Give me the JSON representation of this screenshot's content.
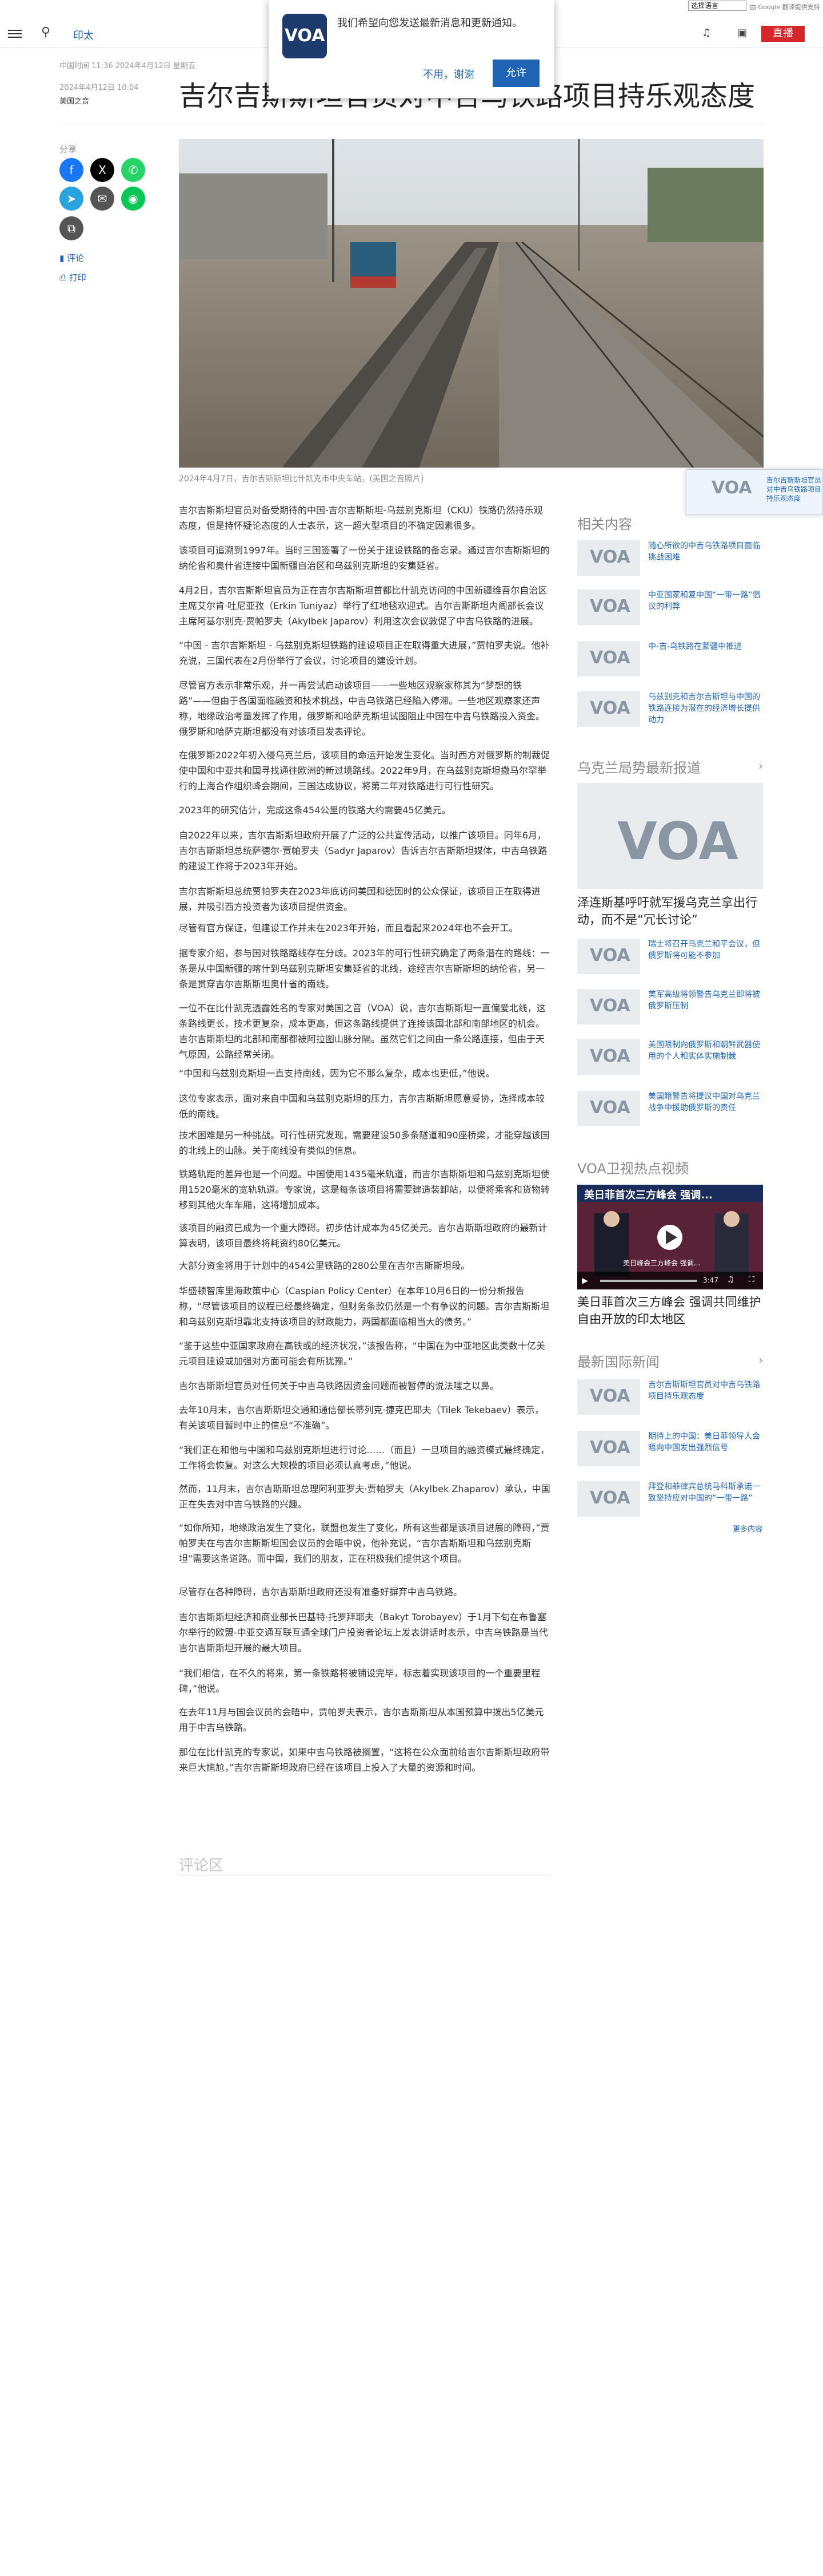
{
  "top": {
    "lang_select": "选择语言",
    "gtranslate": "由 Google 翻译提供支持"
  },
  "header": {
    "lang": "印太",
    "live": "直播"
  },
  "popup": {
    "message": "我们希望向您发送最新消息和更新通知。",
    "no": "不用，谢谢",
    "yes": "允许",
    "logo": "VOA"
  },
  "article": {
    "updated": "中国时间 11:36 2024年4月12日 星期五",
    "date": "2024年4月12日 10:04",
    "author": "美国之音",
    "title": "吉尔吉斯斯坦官员对中吉乌铁路项目持乐观态度",
    "share": "分享",
    "comment": "评论",
    "print": "打印",
    "caption": "2024年4月7日，吉尔吉斯斯坦比什凯克市中央车站。(美国之音照片)",
    "paragraphs": [
      "吉尔吉斯斯坦官员对备受期待的中国-吉尔吉斯斯坦-乌兹别克斯坦（CKU）铁路仍然持乐观态度，但是持怀疑论态度的人士表示，这一超大型项目的不确定因素很多。",
      "该项目可追溯到1997年。当时三国签署了一份关于建设铁路的备忘录。通过吉尔吉斯斯坦的纳伦省和奥什省连接中国新疆自治区和乌兹别克斯坦的安集延省。",
      "4月2日，吉尔吉斯斯坦官员为正在吉尔吉斯斯坦首都比什凯克访问的中国新疆维吾尔自治区主席艾尔肯·吐尼亚孜（Erkin Tuniyaz）举行了红地毯欢迎式。吉尔吉斯斯坦内阁部长会议主席阿基尔别克·贾帕罗夫（Akylbek Japarov）利用这次会议敦促了中吉乌铁路的进展。",
      "“中国 - 吉尔吉斯斯坦 - 乌兹别克斯坦铁路的建设项目正在取得重大进展，”贾帕罗夫说。他补充说，三国代表在2月份举行了会议，讨论项目的建设计划。",
      "尽管官方表示非常乐观，并一再尝试启动该项目——一些地区观察家称其为“梦想的铁路”——但由于各国面临融资和技术挑战，中吉乌铁路已经陷入停滞。一些地区观察家还声称，地缘政治考量发挥了作用，俄罗斯和哈萨克斯坦试图阻止中国在中吉乌铁路投入资金。俄罗斯和哈萨克斯坦都没有对该项目发表评论。",
      "在俄罗斯2022年初入侵乌克兰后，该项目的命运开始发生变化。当时西方对俄罗斯的制裁促使中国和中亚共和国寻找通往欧洲的新过境路线。2022年9月，在乌兹别克斯坦撒马尔罕举行的上海合作组织峰会期间，三国达成协议，将第二年对铁路进行可行性研究。",
      "2023年的研究估计，完成这条454公里的铁路大约需要45亿美元。",
      "自2022年以来，吉尔吉斯斯坦政府开展了广泛的公共宣传活动，以推广该项目。同年6月，吉尔吉斯斯坦总统萨德尔·贾帕罗夫（Sadyr Japarov）告诉吉尔吉斯斯坦媒体，中吉乌铁路的建设工作将于2023年开始。",
      "吉尔吉斯斯坦总统贾帕罗夫在2023年底访问美国和德国时的公众保证，该项目正在取得进展，并吸引西方投资者为该项目提供资金。",
      "尽管有官方保证，但建设工作并未在2023年开始，而且看起来2024年也不会开工。",
      "据专家介绍，参与国对铁路路线存在分歧。2023年的可行性研究确定了两条潜在的路线：一条是从中国新疆的喀什到乌兹别克斯坦安集延省的北线，途经吉尔吉斯斯坦的纳伦省，另一条是贯穿吉尔吉斯斯坦奥什省的南线。",
      "一位不在比什凯克透露姓名的专家对美国之音（VOA）说，吉尔吉斯斯坦一直偏爱北线，这条路线更长，技术更复杂，成本更高，但这条路线提供了连接该国北部和南部地区的机会。吉尔吉斯斯坦的北部和南部都被阿拉图山脉分隔。虽然它们之间由一条公路连接，但由于天气原因，公路经常关闭。",
      "“中国和乌兹别克斯坦一直支持南线，因为它不那么复杂，成本也更低，”他说。",
      "这位专家表示，面对来自中国和乌兹别克斯坦的压力，吉尔吉斯斯坦愿意妥协，选择成本较低的南线。",
      "技术困难是另一种挑战。可行性研究发现，需要建设50多条隧道和90座桥梁，才能穿越该国的北线上的山脉。关于南线没有类似的信息。",
      "铁路轨距的差异也是一个问题。中国使用1435毫米轨道，而吉尔吉斯斯坦和乌兹别克斯坦使用1520毫米的宽轨轨道。专家说，这是每条该项目将需要建造装卸站，以便将乘客和货物转移到其他火车车厢，这将增加成本。",
      "该项目的融资已成为一个重大障碍。初步估计成本为45亿美元。吉尔吉斯斯坦政府的最新计算表明，该项目最终将耗资约80亿美元。",
      "大部分资金将用于计划中的454公里铁路的280公里在吉尔吉斯斯坦段。",
      "华盛顿智库里海政策中心（Caspian Policy Center）在本年10月6日的一份分析报告称，“尽管该项目的议程已经最终确定，但财务条款仍然是一个有争议的问题。吉尔吉斯斯坦和乌兹别克斯坦靠北支持该项目的财政能力，两国都面临相当大的债务。”",
      "“鉴于这些中亚国家政府在高铁或的经济状况，”该报告称，“中国在为中亚地区此类数十亿美元项目建设或加强对方面可能会有所犹豫。”",
      "吉尔吉斯斯坦官员对任何关于中吉乌铁路因资金问题而被暂停的说法嗤之以鼻。",
      "去年10月末，吉尔吉斯斯坦交通和通信部长蒂列克·捷克巴耶夫（Tilek Tekebaev）表示，有关该项目暂时中止的信息“不准确”。",
      "“我们正在和他与中国和乌兹别克斯坦进行讨论……（而且）一旦项目的融资模式最终确定，工作将会恢复。对这么大规模的项目必须认真考虑，”他说。",
      "然而，11月末，吉尔吉斯斯坦总理阿利亚罗夫·贾帕罗夫（Akylbek Zhaparov）承认，中国正在失去对中吉乌铁路的兴趣。",
      "“如你所知，地缘政治发生了变化，联盟也发生了变化，所有这些都是该项目进展的障碍，”贾帕罗夫在与吉尔吉斯斯坦国会议员的会晤中说，他补充说，“吉尔吉斯斯坦和乌兹别克斯坦”需要这条道路。而中国，我们的朋友，正在积极我们提供这个项目。",
      "尽管存在各种障碍，吉尔吉斯斯坦政府还没有准备好摒弃中吉乌铁路。",
      "吉尔吉斯斯坦经济和商业部长巴基特·托罗拜耶夫（Bakyt Torobayev）于1月下旬在布鲁塞尔举行的欧盟-中亚交通互联互通全球门户投资者论坛上发表讲话时表示，中吉乌铁路是当代吉尔吉斯斯坦开展的最大项目。",
      "“我们相信，在不久的将来，第一条铁路将被铺设完毕，标志着实现该项目的一个重要里程碑，”他说。",
      "在去年11月与国会议员的会晤中，贾帕罗夫表示，吉尔吉斯斯坦从本国预算中拨出5亿美元用于中吉乌铁路。",
      "那位在比什凯克的专家说，如果中吉乌铁路被搁置，“这将在公众面前给吉尔吉斯斯坦政府带来巨大尴尬，”吉尔吉斯斯坦政府已经在该项目上投入了大量的资源和时间。"
    ],
    "comments_header": "评论区"
  },
  "sidebar_float": {
    "text": "吉尔吉斯斯坦官员对中吉乌铁路项目持乐观态度",
    "logo": "VOA"
  },
  "right": {
    "related_header": "相关内容",
    "related": [
      {
        "title": "随心所欲的中吉乌铁路项目面临挑战困难"
      },
      {
        "title": "中亚国家和复中国“一带一路”倡议的利弊"
      },
      {
        "title": "中-吉-乌铁路在蒙疆中推进"
      },
      {
        "title": "乌兹别克和吉尔吉斯坦与中国的铁路连接为潜在的经济增长提供动力"
      }
    ],
    "ukraine_header": "乌克兰局势最新报道",
    "ukraine_big_title": "泽连斯基呼吁就军援乌克兰拿出行动，而不是“冗长讨论”",
    "ukraine": [
      {
        "title": "瑞士将召开乌克兰和平会议，但俄罗斯将可能不参加"
      },
      {
        "title": "美军高级将领警告乌克兰即将被俄罗斯压制"
      },
      {
        "title": "美国限制向俄罗斯和朝鲜武器使用的个人和实体实施制裁"
      },
      {
        "title": "美国籍警告将提议中国对乌克兰战争中援助俄罗斯的责任"
      }
    ],
    "video_header": "VOA卫视热点视频",
    "video_overlay": "美日菲首次三方峰会 强调...",
    "video_sub": "美日峰会三方峰会 强调...",
    "video_time": "3:47",
    "video_title": "美日菲首次三方峰会 强调共同维护自由开放的印太地区",
    "intl_header": "最新国际新闻",
    "intl": [
      {
        "title": "吉尔吉斯斯坦官员对中吉乌铁路项目持乐观态度"
      },
      {
        "title": "期待上的中国：美日菲领导人会晤向中国发出强烈信号"
      },
      {
        "title": "拜登和菲律宾总统马科斯承诺一致坚持应对中国的“一带一路”"
      }
    ],
    "more": "更多内容"
  }
}
